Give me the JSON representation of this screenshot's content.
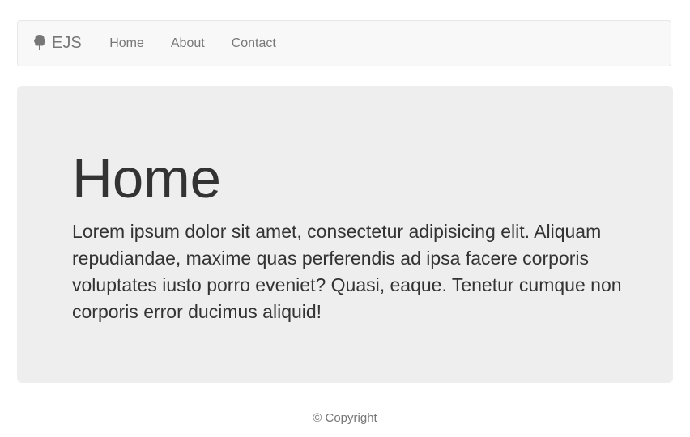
{
  "navbar": {
    "brand_icon": "tree-icon",
    "brand_label": "EJS",
    "links": [
      {
        "label": "Home"
      },
      {
        "label": "About"
      },
      {
        "label": "Contact"
      }
    ]
  },
  "main": {
    "heading": "Home",
    "paragraph": "Lorem ipsum dolor sit amet, consectetur adipisicing elit. Aliquam repudiandae, maxime quas perferendis ad ipsa facere corporis voluptates iusto porro eveniet? Quasi, eaque. Tenetur cumque non corporis error ducimus aliquid!"
  },
  "footer": {
    "copyright": "© Copyright"
  },
  "colors": {
    "navbar_bg": "#f8f8f8",
    "navbar_border": "#e7e7e7",
    "jumbotron_bg": "#eeeeee",
    "nav_text": "#777777",
    "body_text": "#333333"
  }
}
